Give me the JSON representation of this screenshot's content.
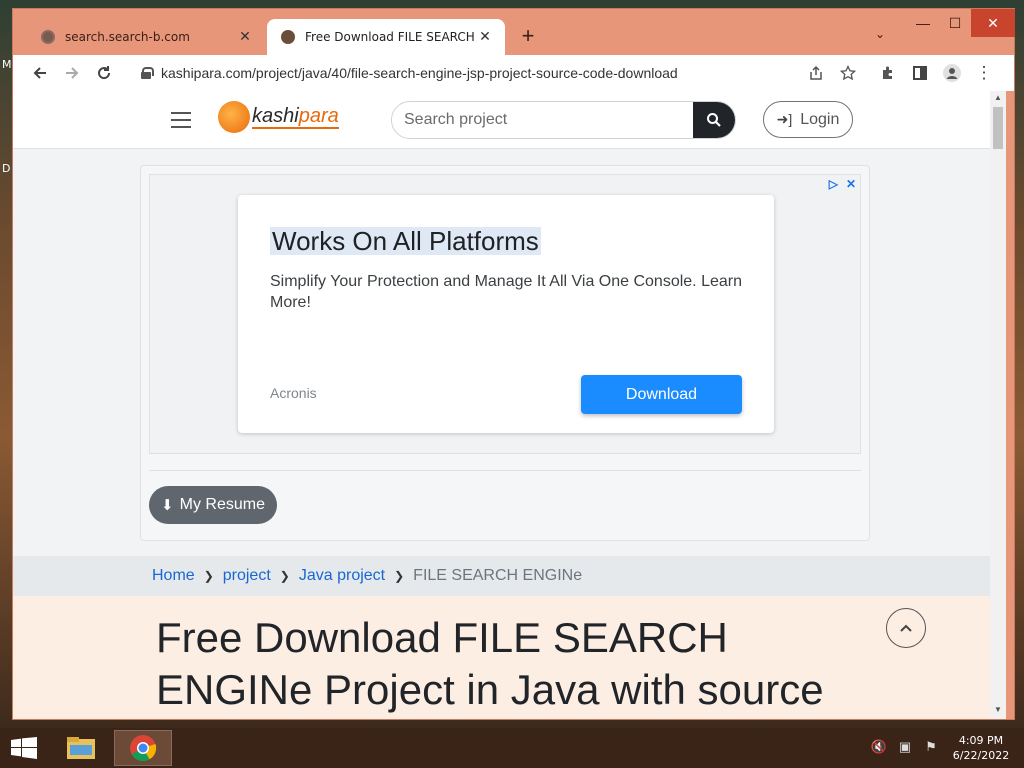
{
  "desktop": {
    "labels": [
      "M",
      "D"
    ]
  },
  "browser": {
    "tabs": [
      {
        "title": "search.search-b.com",
        "active": false
      },
      {
        "title": "Free Download FILE SEARCH ENGINe",
        "active": true
      }
    ],
    "new_tab_glyph": "+",
    "address": "kashipara.com/project/java/40/file-search-engine-jsp-project-source-code-download"
  },
  "site": {
    "logo": {
      "text_main": "kashi",
      "text_accent": "para"
    },
    "search": {
      "placeholder": "Search project"
    },
    "login_label": "Login"
  },
  "ad": {
    "headline": "Works On All Platforms",
    "description": "Simplify Your Protection and Manage It All Via One Console. Learn More!",
    "brand": "Acronis",
    "cta": "Download"
  },
  "resume_label": "My Resume",
  "breadcrumb": {
    "items": [
      "Home",
      "project",
      "Java project"
    ],
    "current": "FILE SEARCH ENGINe"
  },
  "hero": {
    "title": "Free Download FILE SEARCH ENGINe Project in Java with source code"
  },
  "taskbar": {
    "time": "4:09 PM",
    "date": "6/22/2022"
  },
  "colors": {
    "chrome_frame": "#e8967a",
    "close_button": "#c9442c",
    "link": "#1967d2",
    "ad_cta": "#1a8cff",
    "logo_accent": "#e86a0c",
    "hero_bg": "#fdeee4"
  }
}
